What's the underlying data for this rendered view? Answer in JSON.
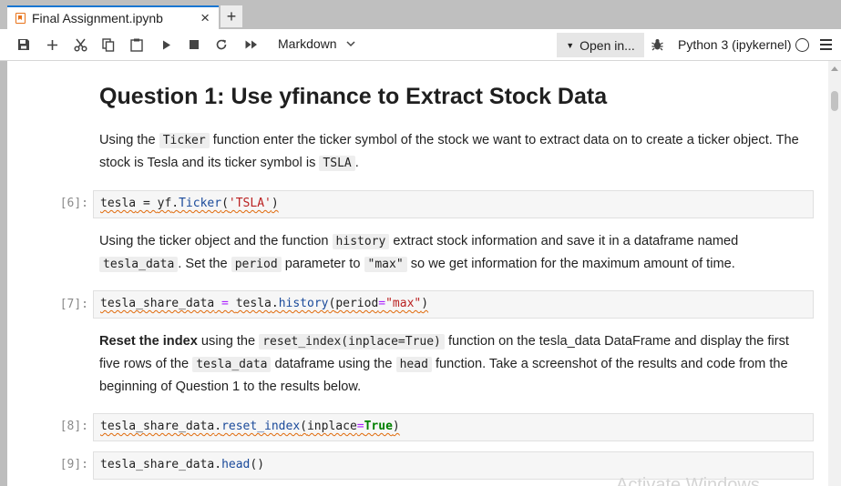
{
  "tab": {
    "title": "Final Assignment.ipynb",
    "close": "×",
    "new_tab": "+"
  },
  "toolbar": {
    "cell_type": "Markdown",
    "open_in": "Open in...",
    "kernel": "Python 3 (ipykernel)",
    "icons": [
      "save-icon",
      "add-cell-icon",
      "cut-icon",
      "copy-icon",
      "paste-icon",
      "run-icon",
      "stop-icon",
      "restart-icon",
      "fast-forward-icon"
    ]
  },
  "notebook": {
    "heading": "Question 1: Use yfinance to Extract Stock Data",
    "md1": {
      "t1": "Using the ",
      "c1": "Ticker",
      "t2": " function enter the ticker symbol of the stock we want to extract data on to create a ticker object. The stock is Tesla and its ticker symbol is ",
      "c2": "TSLA",
      "t3": "."
    },
    "cell6": {
      "prompt": "[6]:",
      "var": "tesla",
      "eq": " = ",
      "mod": "yf",
      "dot": ".",
      "func": "Ticker",
      "open": "(",
      "arg": "'TSLA'",
      "close": ")"
    },
    "md2": {
      "t1": "Using the ticker object and the function ",
      "c1": "history",
      "t2": " extract stock information and save it in a dataframe named ",
      "c2": "tesla_data",
      "t3": ". Set the ",
      "c3": "period",
      "t4": " parameter to ",
      "c4": "\"max\"",
      "t5": " so we get information for the maximum amount of time."
    },
    "cell7": {
      "prompt": "[7]:",
      "var": "tesla_share_data",
      "eq": " = ",
      "obj": "tesla",
      "dot": ".",
      "func": "history",
      "open": "(",
      "param": "period",
      "assign": "=",
      "arg": "\"max\"",
      "close": ")"
    },
    "md3": {
      "bold": "Reset the index",
      "t1": " using the ",
      "c1": "reset_index(inplace=True)",
      "t2": " function on the tesla_data DataFrame and display the first five rows of the ",
      "c2": "tesla_data",
      "t3": " dataframe using the ",
      "c3": "head",
      "t4": " function. Take a screenshot of the results and code from the beginning of Question 1 to the results below."
    },
    "cell8": {
      "prompt": "[8]:",
      "var": "tesla_share_data",
      "dot": ".",
      "func": "reset_index",
      "open": "(",
      "param": "inplace",
      "assign": "=",
      "arg": "True",
      "close": ")"
    },
    "cell9": {
      "prompt": "[9]:",
      "var": "tesla_share_data",
      "dot": ".",
      "func": "head",
      "call": "()"
    }
  },
  "watermark": "Activate Windows",
  "colors": {
    "accent": "#1976d2",
    "notebook_icon": "#e8731a",
    "string": "#ba2121",
    "keyword": "#008000"
  }
}
